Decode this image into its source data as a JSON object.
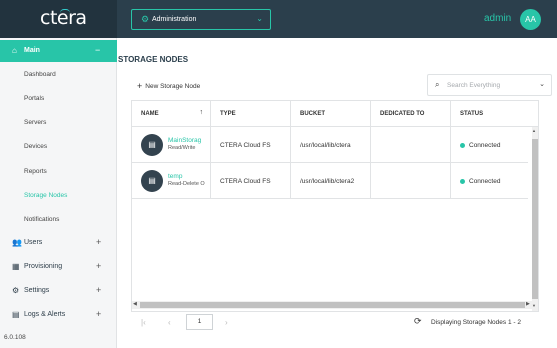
{
  "header": {
    "logo": "ctera",
    "context_select": {
      "label": "Administration"
    },
    "username": "admin",
    "avatar_initials": "AA"
  },
  "sidebar": {
    "main": {
      "label": "Main",
      "toggle": "−"
    },
    "main_items": [
      {
        "label": "Dashboard"
      },
      {
        "label": "Portals"
      },
      {
        "label": "Servers"
      },
      {
        "label": "Devices"
      },
      {
        "label": "Reports"
      },
      {
        "label": "Storage Nodes",
        "active": true
      },
      {
        "label": "Notifications"
      }
    ],
    "sections": [
      {
        "label": "Users",
        "toggle": "+",
        "icon": "users-icon"
      },
      {
        "label": "Provisioning",
        "toggle": "+",
        "icon": "grid-icon"
      },
      {
        "label": "Settings",
        "toggle": "+",
        "icon": "gear-icon"
      },
      {
        "label": "Logs & Alerts",
        "toggle": "+",
        "icon": "log-icon"
      }
    ],
    "version": "6.0.108"
  },
  "main": {
    "title": "STORAGE NODES",
    "new_button": "New Storage Node",
    "search_placeholder": "Search Everything",
    "table": {
      "columns": [
        "NAME",
        "TYPE",
        "BUCKET",
        "DEDICATED TO",
        "STATUS"
      ],
      "rows": [
        {
          "name": "MainStorag",
          "access": "Read/Write",
          "type": "CTERA Cloud FS",
          "bucket": "/usr/local/lib/ctera",
          "dedicated": "",
          "status": "Connected"
        },
        {
          "name": "temp",
          "access": "Read-Delete O",
          "type": "CTERA Cloud FS",
          "bucket": "/usr/local/lib/ctera2",
          "dedicated": "",
          "status": "Connected"
        }
      ]
    },
    "pager": {
      "page": "1",
      "display_text": "Displaying Storage Nodes 1 - 2"
    }
  },
  "colors": {
    "accent": "#28c5a8",
    "header_bg": "#2b3f4c",
    "status_connected": "#28c5a8"
  }
}
